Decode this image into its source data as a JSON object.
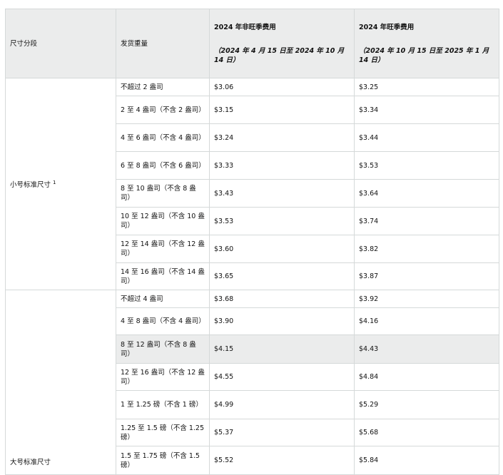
{
  "headers": {
    "tier": "尺寸分段",
    "weight": "发货重量",
    "offpeak_title": "2024 年非旺季费用",
    "offpeak_dates": "（2024 年 4 月 15 日至 2024 年 10 月 14 日）",
    "peak_title": "2024 年旺季费用",
    "peak_dates": "（2024 年 10 月 15 日至 2025 年 1 月 14 日）"
  },
  "small_standard": {
    "label": "小号标准尺寸",
    "footnote": "1",
    "rows": [
      {
        "weight": "不超过 2 盎司",
        "offpeak": "$3.06",
        "peak": "$3.25"
      },
      {
        "weight": "2 至 4 盎司（不含 2 盎司）",
        "offpeak": "$3.15",
        "peak": "$3.34"
      },
      {
        "weight": "4 至 6 盎司（不含 4 盎司）",
        "offpeak": "$3.24",
        "peak": "$3.44"
      },
      {
        "weight": "6 至 8 盎司（不含 6 盎司）",
        "offpeak": "$3.33",
        "peak": "$3.53"
      },
      {
        "weight": "8 至 10 盎司（不含 8 盎司）",
        "offpeak": "$3.43",
        "peak": "$3.64"
      },
      {
        "weight": "10 至 12 盎司（不含 10 盎司）",
        "offpeak": "$3.53",
        "peak": "$3.74"
      },
      {
        "weight": "12 至 14 盎司（不含 12 盎司）",
        "offpeak": "$3.60",
        "peak": "$3.82"
      },
      {
        "weight": "14 至 16 盎司（不含 14 盎司）",
        "offpeak": "$3.65",
        "peak": "$3.87"
      }
    ]
  },
  "large_standard": {
    "label": "大号标准尺寸",
    "rows": [
      {
        "weight": "不超过 4 盎司",
        "offpeak": "$3.68",
        "peak": "$3.92"
      },
      {
        "weight": "4 至 8 盎司（不含 4 盎司）",
        "offpeak": "$3.90",
        "peak": "$4.16"
      },
      {
        "weight": "8 至 12 盎司（不含 8 盎司）",
        "offpeak": "$4.15",
        "peak": "$4.43"
      },
      {
        "weight": "12 至 16 盎司（不含 12 盎司）",
        "offpeak": "$4.55",
        "peak": "$4.84"
      },
      {
        "weight": "1 至 1.25 磅（不含 1 磅）",
        "offpeak": "$4.99",
        "peak": "$5.29"
      },
      {
        "weight": "1.25 至 1.5 磅（不含 1.25 磅）",
        "offpeak": "$5.37",
        "peak": "$5.68"
      },
      {
        "weight": "1.5 至 1.75 磅（不含 1.5 磅）",
        "offpeak": "$5.52",
        "peak": "$5.84"
      }
    ]
  }
}
